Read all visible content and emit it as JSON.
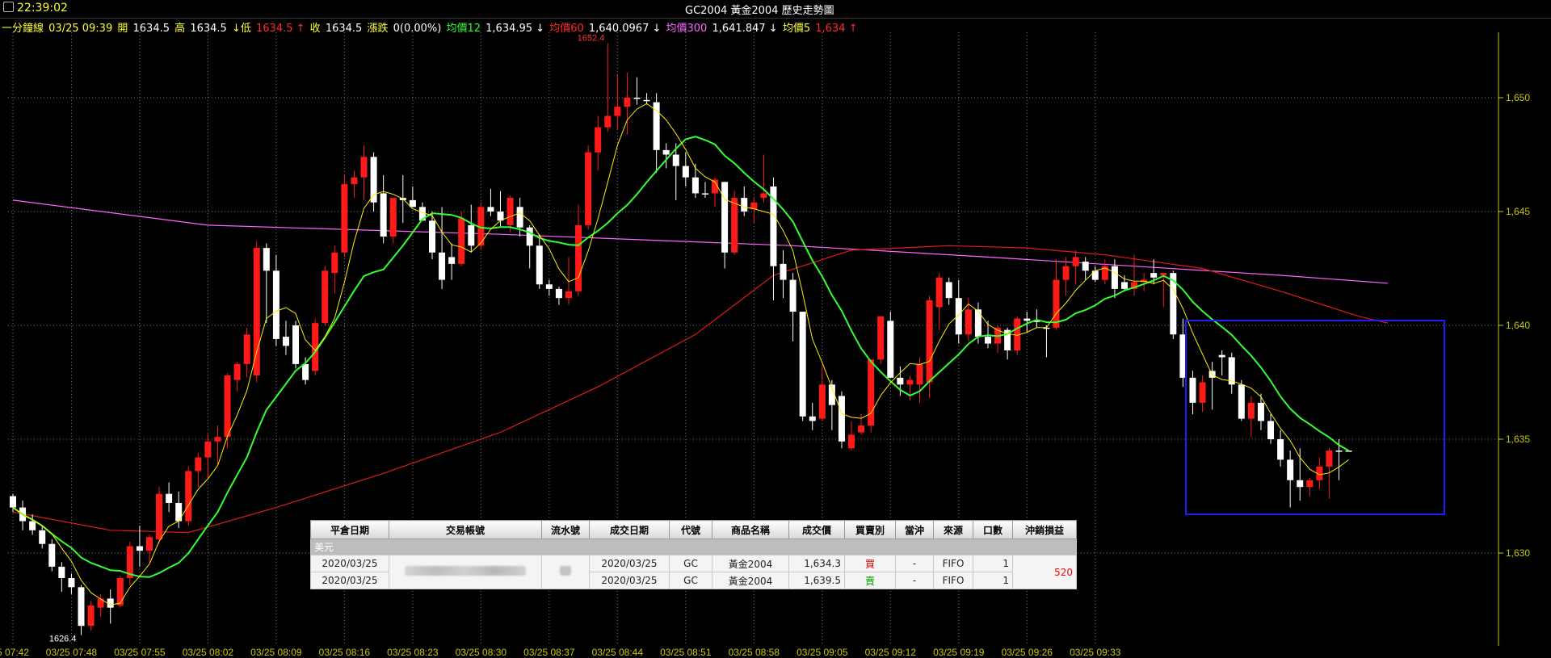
{
  "window": {
    "clock": "22:39:02",
    "title": "GC2004 黃金2004  歷史走勢圖"
  },
  "info": {
    "period_label": "一分鐘線",
    "datetime": "03/25 09:39",
    "open_label": "開",
    "open": "1634.5",
    "high_label": "高",
    "high": "1634.5",
    "low_label": "↓低",
    "low": "1634.5 ↑",
    "close_label": "收",
    "close": "1634.5",
    "change_label": "漲跌",
    "change": "0(0.00%)",
    "ma12_label": "均價12",
    "ma12": "1,634.95 ↓",
    "ma60_label": "均價60",
    "ma60": "1,640.0967 ↓",
    "ma300_label": "均價300",
    "ma300": "1,641.847 ↓",
    "ma5_label": "均價5",
    "ma5": "1,634 ↑"
  },
  "colors": {
    "up": "#ff1a1a",
    "down": "#ffffff",
    "ma5": "#ffee00",
    "ma12": "#33ff33",
    "ma60": "#e01a1a",
    "ma300": "#ff66ff",
    "axis": "#c8c800",
    "grid": "#7a7a7a",
    "highlight_box": "#1c1cff"
  },
  "annotations": {
    "high_marker": "1652.4",
    "low_marker": "1626.4"
  },
  "chart_data": {
    "type": "candlestick",
    "title": "GC2004 黃金2004  歷史走勢圖",
    "ylim": [
      1626,
      1652.5
    ],
    "y_ticks": [
      "1,630",
      "1,635",
      "1,640",
      "1,645",
      "1,650"
    ],
    "y_tick_values": [
      1630,
      1635,
      1640,
      1645,
      1650
    ],
    "x_ticks": [
      "5 07:42",
      "03/25 07:48",
      "03/25 07:55",
      "03/25 08:02",
      "03/25 08:09",
      "03/25 08:16",
      "03/25 08:23",
      "03/25 08:30",
      "03/25 08:37",
      "03/25 08:44",
      "03/25 08:51",
      "03/25 08:58",
      "03/25 09:05",
      "03/25 09:12",
      "03/25 09:19",
      "03/25 09:26",
      "03/25 09:33"
    ],
    "x_tick_indices": [
      0,
      6,
      13,
      20,
      27,
      34,
      41,
      48,
      55,
      62,
      69,
      76,
      83,
      90,
      97,
      104,
      111
    ],
    "ohlc": [
      [
        1632.5,
        1632.6,
        1631.8,
        1632.0
      ],
      [
        1632.0,
        1632.3,
        1631.0,
        1631.4
      ],
      [
        1631.4,
        1631.7,
        1630.8,
        1631.0
      ],
      [
        1631.0,
        1631.2,
        1630.2,
        1630.4
      ],
      [
        1630.4,
        1630.6,
        1629.2,
        1629.4
      ],
      [
        1629.4,
        1629.6,
        1628.3,
        1628.9
      ],
      [
        1628.9,
        1629.1,
        1628.2,
        1628.5
      ],
      [
        1628.5,
        1628.6,
        1626.4,
        1626.8
      ],
      [
        1626.8,
        1627.9,
        1626.6,
        1627.7
      ],
      [
        1627.6,
        1628.2,
        1627.2,
        1628.0
      ],
      [
        1628.0,
        1628.4,
        1626.9,
        1627.6
      ],
      [
        1627.7,
        1629.0,
        1627.6,
        1628.9
      ],
      [
        1628.9,
        1630.5,
        1628.6,
        1630.3
      ],
      [
        1630.3,
        1631.2,
        1629.4,
        1630.1
      ],
      [
        1630.1,
        1630.8,
        1629.6,
        1630.7
      ],
      [
        1630.6,
        1632.9,
        1630.4,
        1632.6
      ],
      [
        1632.6,
        1633.1,
        1631.8,
        1632.2
      ],
      [
        1632.2,
        1632.7,
        1631.1,
        1631.4
      ],
      [
        1631.4,
        1633.8,
        1631.2,
        1633.6
      ],
      [
        1633.6,
        1634.4,
        1632.9,
        1634.2
      ],
      [
        1634.2,
        1635.2,
        1633.3,
        1634.9
      ],
      [
        1634.9,
        1635.6,
        1633.9,
        1635.1
      ],
      [
        1635.1,
        1637.9,
        1634.6,
        1637.8
      ],
      [
        1637.6,
        1638.4,
        1637.1,
        1638.3
      ],
      [
        1638.3,
        1639.9,
        1637.7,
        1639.6
      ],
      [
        1637.8,
        1643.7,
        1637.5,
        1643.4
      ],
      [
        1643.4,
        1643.6,
        1640.1,
        1642.4
      ],
      [
        1642.4,
        1643.1,
        1639.1,
        1639.4
      ],
      [
        1639.5,
        1640.2,
        1638.7,
        1639.1
      ],
      [
        1640.0,
        1640.2,
        1638.1,
        1638.3
      ],
      [
        1638.3,
        1638.6,
        1637.4,
        1637.6
      ],
      [
        1638.0,
        1640.3,
        1637.8,
        1640.1
      ],
      [
        1640.1,
        1642.6,
        1640.0,
        1642.4
      ],
      [
        1642.3,
        1643.5,
        1641.4,
        1643.2
      ],
      [
        1643.2,
        1646.6,
        1643.0,
        1646.2
      ],
      [
        1646.2,
        1646.8,
        1645.6,
        1646.5
      ],
      [
        1646.5,
        1647.9,
        1645.5,
        1647.4
      ],
      [
        1647.4,
        1647.6,
        1645.0,
        1645.4
      ],
      [
        1645.8,
        1646.6,
        1643.6,
        1643.9
      ],
      [
        1643.9,
        1645.6,
        1643.6,
        1645.6
      ],
      [
        1645.6,
        1646.6,
        1644.5,
        1645.5
      ],
      [
        1645.5,
        1646.1,
        1645.2,
        1645.2
      ],
      [
        1645.2,
        1645.4,
        1644.8,
        1644.6
      ],
      [
        1644.6,
        1645.0,
        1642.9,
        1643.2
      ],
      [
        1643.2,
        1645.2,
        1641.6,
        1642.0
      ],
      [
        1643.0,
        1643.6,
        1642.0,
        1642.7
      ],
      [
        1642.7,
        1645.0,
        1642.6,
        1644.7
      ],
      [
        1644.4,
        1645.3,
        1643.2,
        1643.5
      ],
      [
        1643.5,
        1645.4,
        1643.3,
        1645.2
      ],
      [
        1645.2,
        1646.0,
        1644.8,
        1645.0
      ],
      [
        1645.0,
        1645.9,
        1644.3,
        1644.6
      ],
      [
        1644.4,
        1645.7,
        1644.1,
        1645.6
      ],
      [
        1645.2,
        1645.6,
        1643.9,
        1644.3
      ],
      [
        1644.3,
        1644.4,
        1642.5,
        1643.5
      ],
      [
        1643.5,
        1644.0,
        1641.6,
        1641.8
      ],
      [
        1641.8,
        1642.0,
        1641.3,
        1641.6
      ],
      [
        1641.6,
        1641.7,
        1640.9,
        1641.2
      ],
      [
        1641.2,
        1643.0,
        1640.9,
        1641.5
      ],
      [
        1641.5,
        1645.3,
        1641.3,
        1644.4
      ],
      [
        1644.4,
        1647.9,
        1644.2,
        1647.6
      ],
      [
        1647.6,
        1649.2,
        1646.8,
        1648.7
      ],
      [
        1648.7,
        1652.4,
        1648.5,
        1649.2
      ],
      [
        1649.2,
        1651.0,
        1648.6,
        1649.6
      ],
      [
        1649.6,
        1651.1,
        1648.4,
        1650.0
      ],
      [
        1650.0,
        1650.9,
        1649.7,
        1650.0
      ],
      [
        1649.9,
        1650.2,
        1649.7,
        1649.9
      ],
      [
        1649.8,
        1650.2,
        1646.7,
        1647.7
      ],
      [
        1647.7,
        1648.0,
        1646.9,
        1647.5
      ],
      [
        1647.5,
        1648.0,
        1645.5,
        1647.0
      ],
      [
        1647.0,
        1647.6,
        1646.1,
        1646.5
      ],
      [
        1646.5,
        1647.1,
        1645.6,
        1645.8
      ],
      [
        1645.8,
        1646.3,
        1645.6,
        1645.8
      ],
      [
        1645.8,
        1646.5,
        1645.2,
        1646.4
      ],
      [
        1646.3,
        1646.3,
        1642.5,
        1643.2
      ],
      [
        1643.2,
        1645.9,
        1643.1,
        1645.6
      ],
      [
        1645.6,
        1646.1,
        1644.8,
        1645.0
      ],
      [
        1645.1,
        1645.6,
        1644.5,
        1645.4
      ],
      [
        1645.6,
        1647.5,
        1645.4,
        1645.8
      ],
      [
        1646.1,
        1646.5,
        1641.1,
        1642.6
      ],
      [
        1642.7,
        1643.3,
        1641.2,
        1642.0
      ],
      [
        1642.0,
        1642.3,
        1639.3,
        1640.6
      ],
      [
        1640.6,
        1640.6,
        1635.8,
        1636.0
      ],
      [
        1636.0,
        1636.6,
        1635.4,
        1635.8
      ],
      [
        1635.9,
        1638.2,
        1635.8,
        1637.4
      ],
      [
        1637.4,
        1637.6,
        1635.4,
        1636.5
      ],
      [
        1636.9,
        1637.1,
        1634.6,
        1634.9
      ],
      [
        1634.6,
        1635.8,
        1634.5,
        1635.2
      ],
      [
        1635.3,
        1636.1,
        1635.2,
        1635.6
      ],
      [
        1635.6,
        1637.3,
        1635.3,
        1638.5
      ],
      [
        1638.5,
        1640.4,
        1638.3,
        1640.4
      ],
      [
        1640.2,
        1640.6,
        1637.8,
        1637.7
      ],
      [
        1637.7,
        1638.2,
        1636.9,
        1637.4
      ],
      [
        1637.4,
        1637.8,
        1636.7,
        1637.6
      ],
      [
        1637.4,
        1638.6,
        1636.6,
        1638.3
      ],
      [
        1637.5,
        1641.3,
        1636.8,
        1641.1
      ],
      [
        1640.8,
        1642.3,
        1639.8,
        1642.1
      ],
      [
        1641.9,
        1642.1,
        1640.9,
        1641.2
      ],
      [
        1641.2,
        1642.0,
        1639.2,
        1639.6
      ],
      [
        1639.6,
        1641.2,
        1639.3,
        1640.7
      ],
      [
        1640.7,
        1641.0,
        1639.2,
        1639.5
      ],
      [
        1639.5,
        1640.2,
        1639.0,
        1639.2
      ],
      [
        1639.2,
        1640.0,
        1638.8,
        1639.9
      ],
      [
        1639.8,
        1639.9,
        1638.5,
        1638.9
      ],
      [
        1638.9,
        1640.4,
        1638.7,
        1640.3
      ],
      [
        1640.3,
        1640.6,
        1639.7,
        1640.2
      ],
      [
        1640.2,
        1640.7,
        1639.9,
        1640.2
      ],
      [
        1639.9,
        1640.0,
        1638.6,
        1639.9
      ],
      [
        1639.9,
        1642.9,
        1639.8,
        1642.0
      ],
      [
        1642.0,
        1643.0,
        1641.3,
        1642.6
      ],
      [
        1642.6,
        1643.3,
        1641.8,
        1643.0
      ],
      [
        1642.8,
        1643.0,
        1642.0,
        1642.4
      ],
      [
        1642.4,
        1642.6,
        1641.9,
        1642.0
      ],
      [
        1642.0,
        1642.9,
        1641.8,
        1642.6
      ],
      [
        1642.6,
        1642.9,
        1641.2,
        1641.6
      ],
      [
        1641.9,
        1642.2,
        1641.5,
        1641.6
      ],
      [
        1641.6,
        1643.1,
        1641.3,
        1641.9
      ],
      [
        1641.9,
        1642.3,
        1641.5,
        1642.0
      ],
      [
        1642.3,
        1642.9,
        1641.8,
        1642.1
      ],
      [
        1642.2,
        1642.3,
        1640.8,
        1642.3
      ],
      [
        1642.3,
        1642.4,
        1639.4,
        1639.6
      ],
      [
        1639.6,
        1640.3,
        1637.3,
        1637.7
      ],
      [
        1637.7,
        1638.0,
        1636.1,
        1636.6
      ],
      [
        1636.6,
        1637.8,
        1636.2,
        1637.5
      ],
      [
        1638.0,
        1638.4,
        1636.3,
        1637.7
      ],
      [
        1638.7,
        1638.9,
        1637.8,
        1638.6
      ],
      [
        1638.6,
        1638.8,
        1637.0,
        1637.4
      ],
      [
        1637.4,
        1637.6,
        1635.8,
        1635.9
      ],
      [
        1635.9,
        1636.9,
        1635.1,
        1636.6
      ],
      [
        1636.6,
        1637.0,
        1635.4,
        1635.8
      ],
      [
        1635.8,
        1636.1,
        1634.8,
        1635.0
      ],
      [
        1635.0,
        1635.4,
        1633.8,
        1634.1
      ],
      [
        1634.1,
        1634.5,
        1632.0,
        1633.2
      ],
      [
        1633.2,
        1634.6,
        1632.3,
        1632.9
      ],
      [
        1632.9,
        1633.3,
        1632.5,
        1633.2
      ],
      [
        1633.2,
        1634.2,
        1632.8,
        1633.8
      ],
      [
        1633.8,
        1634.6,
        1632.4,
        1634.5
      ],
      [
        1634.5,
        1635.0,
        1633.2,
        1634.5
      ],
      [
        1634.5,
        1634.5,
        1634.5,
        1634.5
      ]
    ],
    "ma300": [
      [
        0,
        1645.5
      ],
      [
        20,
        1644.4
      ],
      [
        50,
        1644.0
      ],
      [
        80,
        1643.5
      ],
      [
        100,
        1643.0
      ],
      [
        115,
        1642.6
      ],
      [
        130,
        1642.2
      ],
      [
        141,
        1641.85
      ]
    ],
    "ma60": [
      [
        0,
        1631.8
      ],
      [
        10,
        1631.0
      ],
      [
        18,
        1630.9
      ],
      [
        27,
        1632.0
      ],
      [
        38,
        1633.5
      ],
      [
        50,
        1635.3
      ],
      [
        60,
        1637.3
      ],
      [
        70,
        1639.6
      ],
      [
        78,
        1642.2
      ],
      [
        86,
        1643.3
      ],
      [
        96,
        1643.5
      ],
      [
        104,
        1643.4
      ],
      [
        112,
        1643.1
      ],
      [
        122,
        1642.5
      ],
      [
        130,
        1641.5
      ],
      [
        138,
        1640.4
      ],
      [
        141,
        1640.1
      ]
    ]
  },
  "trade_table": {
    "headers": [
      "平倉日期",
      "交易帳號",
      "流水號",
      "成交日期",
      "代號",
      "商品名稱",
      "成交價",
      "買賣別",
      "當沖",
      "來源",
      "口數",
      "沖銷損益"
    ],
    "group_label": "美元",
    "rows": [
      {
        "close_date": "2020/03/25",
        "trade_date": "2020/03/25",
        "code": "GC",
        "name": "黃金2004",
        "price": "1,634.3",
        "side": "買",
        "daytrade": "-",
        "source": "FIFO",
        "qty": "1"
      },
      {
        "close_date": "2020/03/25",
        "trade_date": "2020/03/25",
        "code": "GC",
        "name": "黃金2004",
        "price": "1,639.5",
        "side": "賣",
        "daytrade": "-",
        "source": "FIFO",
        "qty": "1"
      }
    ],
    "pnl": "520"
  }
}
